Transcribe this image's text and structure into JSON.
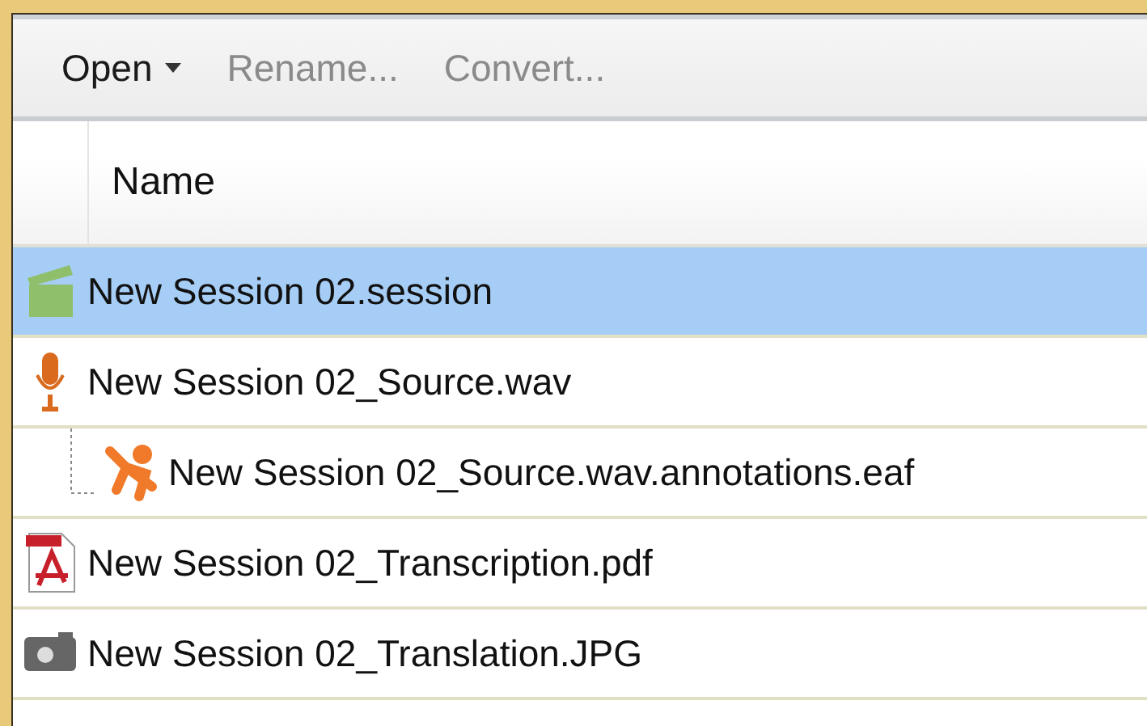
{
  "toolbar": [
    {
      "label": "Open",
      "kind": "menu",
      "disabled": false
    },
    {
      "label": "Rename...",
      "kind": "plain",
      "disabled": true
    },
    {
      "label": "Convert...",
      "kind": "plain",
      "disabled": true
    }
  ],
  "table": {
    "columns": [
      "Name"
    ],
    "rows": [
      {
        "name": "New Session 02.session",
        "kind": "session",
        "selected": true
      },
      {
        "name": "New Session 02_Source.wav",
        "kind": "audio",
        "selected": false,
        "children": [
          {
            "name": "New Session 02_Source.wav.annotations.eaf",
            "kind": "annotation",
            "selected": false
          }
        ]
      },
      {
        "name": "New Session 02_Transcription.pdf",
        "kind": "pdf",
        "selected": false
      },
      {
        "name": "New Session 02_Translation.JPG",
        "kind": "image",
        "selected": false
      }
    ]
  }
}
